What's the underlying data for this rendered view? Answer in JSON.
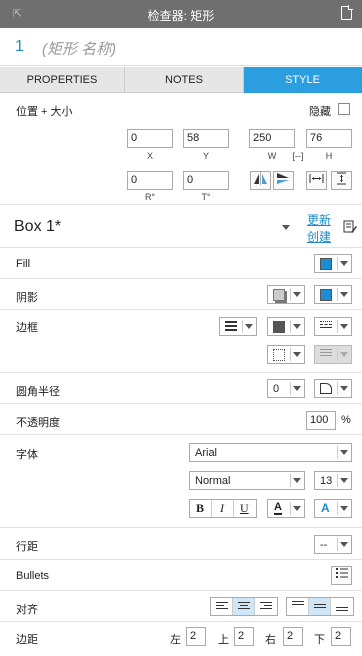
{
  "window": {
    "title": "检查器: 矩形"
  },
  "shape": {
    "number": "1",
    "name": "(矩形 名称)"
  },
  "tabs": [
    {
      "label": "PROPERTIES"
    },
    {
      "label": "NOTES"
    },
    {
      "label": "STYLE"
    }
  ],
  "position": {
    "label": "位置 + 大小",
    "hide_label": "隐藏",
    "x": {
      "value": "0",
      "caption": "X"
    },
    "y": {
      "value": "58",
      "caption": "Y"
    },
    "w": {
      "value": "250",
      "caption": "W"
    },
    "h": {
      "value": "76",
      "caption": "H"
    },
    "lock_caption": "[--]",
    "rotation": {
      "value": "0",
      "caption": "R°"
    },
    "text_rotation": {
      "value": "0",
      "caption": "T°"
    }
  },
  "style": {
    "name": "Box 1*",
    "update_link": "更新",
    "create_link": "创建"
  },
  "fill": {
    "label": "Fill",
    "color": "#1e8bd6"
  },
  "shadow": {
    "label": "阴影",
    "color": "#1e8bd6"
  },
  "border": {
    "label": "边框"
  },
  "corner": {
    "label": "圆角半径",
    "value": "0"
  },
  "opacity": {
    "label": "不透明度",
    "value": "100",
    "unit": "%"
  },
  "font": {
    "label": "字体",
    "family": "Arial",
    "weight": "Normal",
    "size": "13",
    "bold": "B",
    "italic": "I",
    "underline": "U",
    "color_letter": "A",
    "effect_letter": "A"
  },
  "line_spacing": {
    "label": "行距",
    "value": "--"
  },
  "bullets": {
    "label": "Bullets"
  },
  "align": {
    "label": "对齐"
  },
  "padding": {
    "label": "边距",
    "left_label": "左",
    "left": "2",
    "top_label": "上",
    "top": "2",
    "right_label": "右",
    "right": "2",
    "bottom_label": "下",
    "bottom": "2"
  },
  "colors": {
    "accent": "#2b9ee0",
    "titlebar": "#6f6f6f"
  }
}
